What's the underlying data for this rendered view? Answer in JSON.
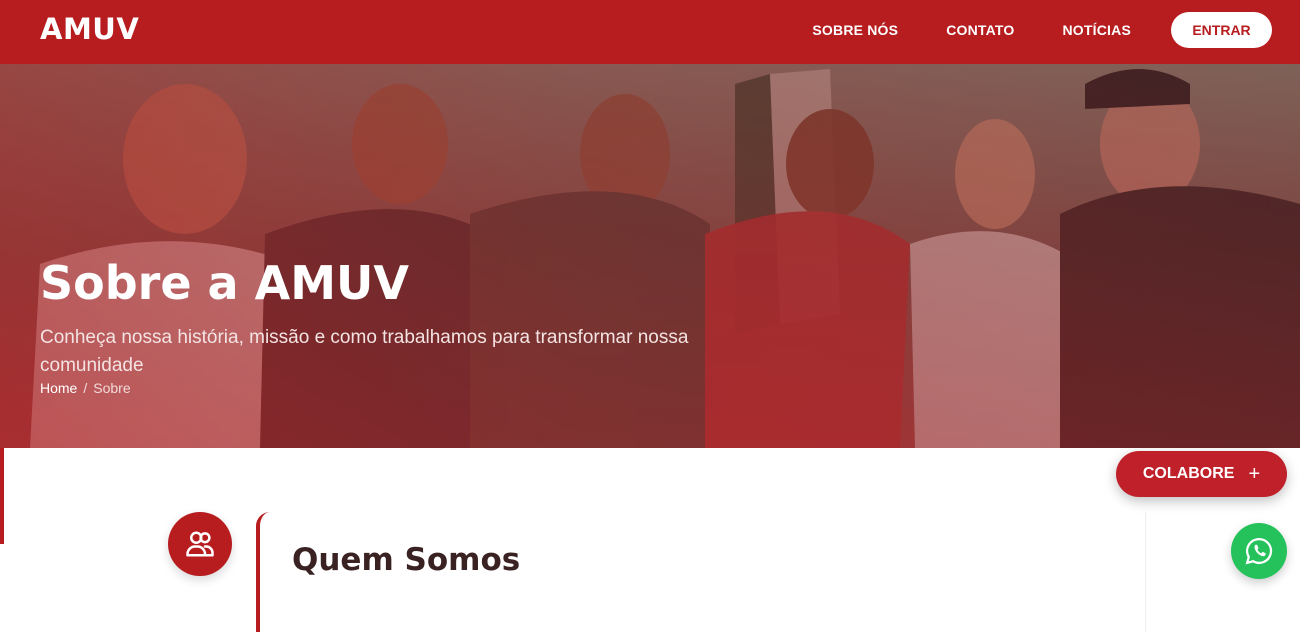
{
  "header": {
    "logo": "AMUV",
    "nav": [
      {
        "label": "SOBRE NÓS"
      },
      {
        "label": "CONTATO"
      },
      {
        "label": "NOTÍCIAS"
      }
    ],
    "login_label": "ENTRAR"
  },
  "hero": {
    "title": "Sobre a AMUV",
    "subtitle": "Conheça nossa história, missão e como trabalhamos para transformar nossa comunidade",
    "breadcrumb": {
      "home": "Home",
      "separator": "/",
      "current": "Sobre"
    }
  },
  "section": {
    "icon": "users-icon",
    "title": "Quem Somos"
  },
  "floating": {
    "colabore_label": "COLABORE",
    "colabore_icon": "plus-icon",
    "whatsapp_icon": "whatsapp-icon"
  },
  "colors": {
    "brand": "#b71c1f",
    "whatsapp": "#25c15a"
  }
}
